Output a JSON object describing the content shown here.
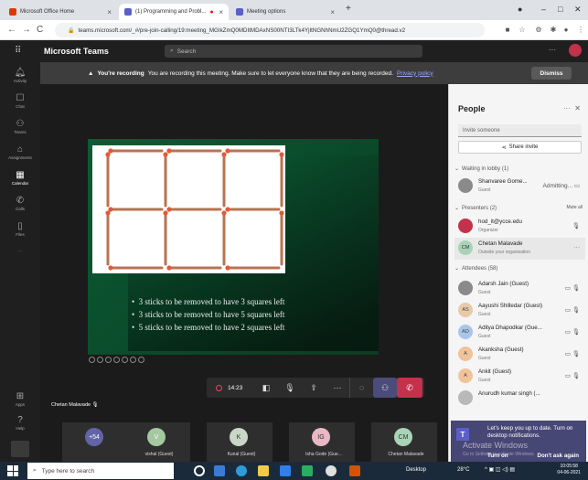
{
  "browser": {
    "tabs": [
      {
        "label": "Microsoft Office Home",
        "color": "#d83b01"
      },
      {
        "label": "(1) Programming and Probl...",
        "color": "#5b5fc7"
      },
      {
        "label": "Meeting options",
        "color": "#5b5fc7"
      }
    ],
    "new_tab": "+",
    "url": "teams.microsoft.com/_#/pre-join-calling/19:meeting_MGIkZmQ0MDItMDAxNS00NTI3LTk4YjItNGNhNmU2ZGQ1YmQ0@thread.v2"
  },
  "teams": {
    "app_title": "Microsoft Teams",
    "search_placeholder": "Search",
    "more": "···"
  },
  "rail": [
    {
      "label": "Activity",
      "icon": "bell-icon"
    },
    {
      "label": "Chat",
      "icon": "chat-icon"
    },
    {
      "label": "Teams",
      "icon": "teams-icon"
    },
    {
      "label": "Assignments",
      "icon": "assignments-icon"
    },
    {
      "label": "Calendar",
      "icon": "calendar-icon"
    },
    {
      "label": "Calls",
      "icon": "calls-icon"
    },
    {
      "label": "Files",
      "icon": "files-icon"
    },
    {
      "label": "···",
      "icon": "more-icon"
    },
    {
      "label": "Apps",
      "icon": "apps-icon"
    },
    {
      "label": "Help",
      "icon": "help-icon"
    }
  ],
  "banner": {
    "bold": "You're recording",
    "text": "You are recording this meeting. Make sure to let everyone know that they are being recorded.",
    "link": "Privacy policy",
    "dismiss": "Dismiss"
  },
  "slide": {
    "bullets": [
      "3 sticks to be removed to have 3 squares left",
      "3 sticks to be removed to have 5 squares left",
      "5 sticks to be removed to have 2 squares left"
    ],
    "bullet_char": "•"
  },
  "self_name": "Chetan Malavade",
  "controls": {
    "timer": "14:23"
  },
  "participants_strip": [
    {
      "initials": "+54",
      "name": "",
      "color": "#6264a7"
    },
    {
      "initials": "V",
      "name": "vishal (Guest)",
      "color": "#a4c8a0"
    },
    {
      "initials": "K",
      "name": "Kunal (Guest)",
      "color": "#c9d6c8"
    },
    {
      "initials": "IG",
      "name": "Isha Gode (Gue...",
      "color": "#e8b8c4"
    },
    {
      "initials": "CM",
      "name": "Chetan Malavade",
      "color": "#a9d3b7"
    }
  ],
  "people": {
    "title": "People",
    "invite_placeholder": "Invite someone",
    "share_invite": "Share invite",
    "lobby_header": "Waiting in lobby (1)",
    "lobby": [
      {
        "name": "Shanvaree Gome...",
        "sub": "Guest",
        "status": "Admitting..."
      }
    ],
    "presenters_header": "Presenters (2)",
    "mute_all": "Mute all",
    "presenters": [
      {
        "name": "hod_it@ycce.edu",
        "sub": "Organizer",
        "initials": "",
        "color": "#c4314b"
      },
      {
        "name": "Chetan Malavade",
        "sub": "Outside your organisation",
        "initials": "CM",
        "color": "#a9d3b7"
      }
    ],
    "attendees_header": "Attendees (58)",
    "attendees": [
      {
        "name": "Adarsh Jain (Guest)",
        "sub": "Guest",
        "initials": "",
        "color": "#8a8a8a"
      },
      {
        "name": "Aayushi Shilledar (Guest)",
        "sub": "Guest",
        "initials": "AS",
        "color": "#e8c9a8"
      },
      {
        "name": "Aditya Dhapodkar (Gue...",
        "sub": "Guest",
        "initials": "AD",
        "color": "#a8c6e8"
      },
      {
        "name": "Akanksha (Guest)",
        "sub": "Guest",
        "initials": "A",
        "color": "#f0c39a"
      },
      {
        "name": "Ankit (Guest)",
        "sub": "Guest",
        "initials": "A",
        "color": "#f0c39a"
      },
      {
        "name": "Anurudh kumar singh (...",
        "sub": "",
        "initials": "",
        "color": "#b9b9b9"
      }
    ]
  },
  "toast": {
    "message": "Let's keep you up to date. Turn on desktop notifications.",
    "turn_on": "Turn on",
    "dont_ask": "Don't ask again"
  },
  "watermark": {
    "title": "Activate Windows",
    "sub": "Go to Settings to activate Windows."
  },
  "taskbar": {
    "search_placeholder": "Type here to search",
    "desktop": "Desktop",
    "temperature": "28°C",
    "time": "10:05:58",
    "date": "04-06-2021"
  }
}
